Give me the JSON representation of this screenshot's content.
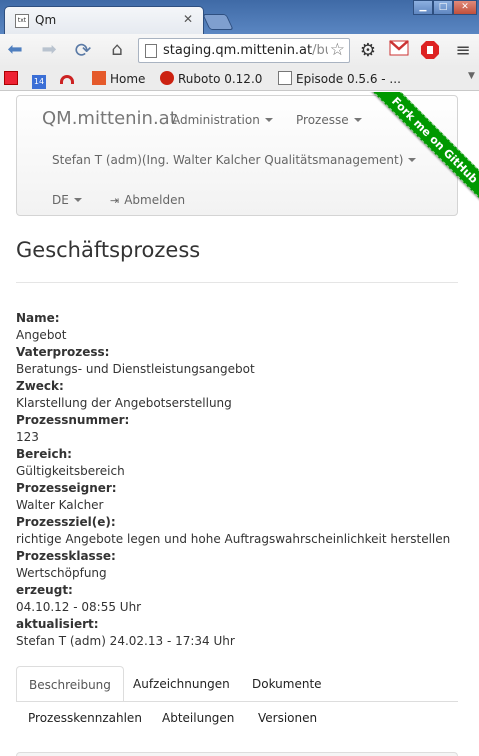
{
  "browser": {
    "tab_title": "Qm",
    "tab_favicon_text": "txt",
    "url_main": "staging.qm.mittenin.at",
    "url_rest": "/bus"
  },
  "bookmarks": [
    {
      "label": ""
    },
    {
      "label": ""
    },
    {
      "label": ""
    },
    {
      "label": "Home"
    },
    {
      "label": "Ruboto 0.12.0"
    },
    {
      "label": "Episode 0.5.6 - ..."
    }
  ],
  "navbar": {
    "brand": "QM.mittenin.at",
    "administration": "Administration",
    "prozesse": "Prozesse",
    "user": "Stefan T (adm)(Ing. Walter Kalcher Qualitätsmanagement)",
    "language": "DE",
    "logout": "Abmelden",
    "ribbon": "Fork me on GitHub"
  },
  "page": {
    "title": "Geschäftsprozess"
  },
  "details": [
    {
      "label": "Name:",
      "value": "Angebot"
    },
    {
      "label": "Vaterprozess:",
      "value": "Beratungs- und Dienstleistungsangebot"
    },
    {
      "label": "Zweck:",
      "value": "Klarstellung der Angebotserstellung"
    },
    {
      "label": "Prozessnummer:",
      "value": "123"
    },
    {
      "label": "Bereich:",
      "value": "Gültigkeitsbereich"
    },
    {
      "label": "Prozesseigner:",
      "value": "Walter Kalcher"
    },
    {
      "label": "Prozessziel(e):",
      "value": "richtige Angebote legen und hohe Auftragswahrscheinlichkeit herstellen"
    },
    {
      "label": "Prozessklasse:",
      "value": "Wertschöpfung"
    },
    {
      "label": "erzeugt:",
      "value": "04.10.12 - 08:55 Uhr"
    },
    {
      "label": "aktualisiert:",
      "value": "Stefan T (adm) 24.02.13 - 17:34 Uhr"
    }
  ],
  "tabs": {
    "row1": [
      "Beschreibung",
      "Aufzeichnungen",
      "Dokumente"
    ],
    "row2": [
      "Prozesskennzahlen",
      "Abteilungen",
      "Versionen"
    ]
  },
  "colors": {
    "ribbon": "#009900",
    "chrome_blue": "#4a76b2"
  }
}
